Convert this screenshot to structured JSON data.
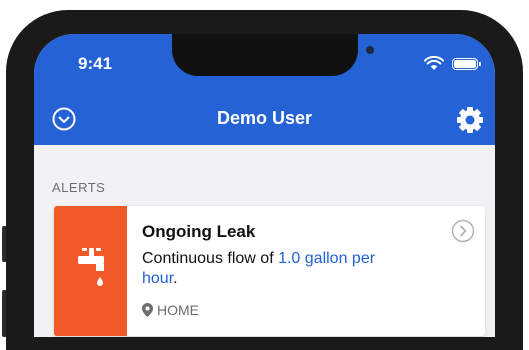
{
  "status_bar": {
    "time": "9:41"
  },
  "header": {
    "title": "Demo User"
  },
  "alerts": {
    "section_label": "ALERTS",
    "items": [
      {
        "title": "Ongoing Leak",
        "body_prefix": "Continuous flow of ",
        "body_highlight": "1.0 gallon per hour",
        "body_suffix": ".",
        "location": "HOME",
        "icon": "faucet-icon"
      }
    ]
  },
  "colors": {
    "brand": "#2462d6",
    "alert_accent": "#f05a28",
    "highlight": "#2462d6"
  }
}
